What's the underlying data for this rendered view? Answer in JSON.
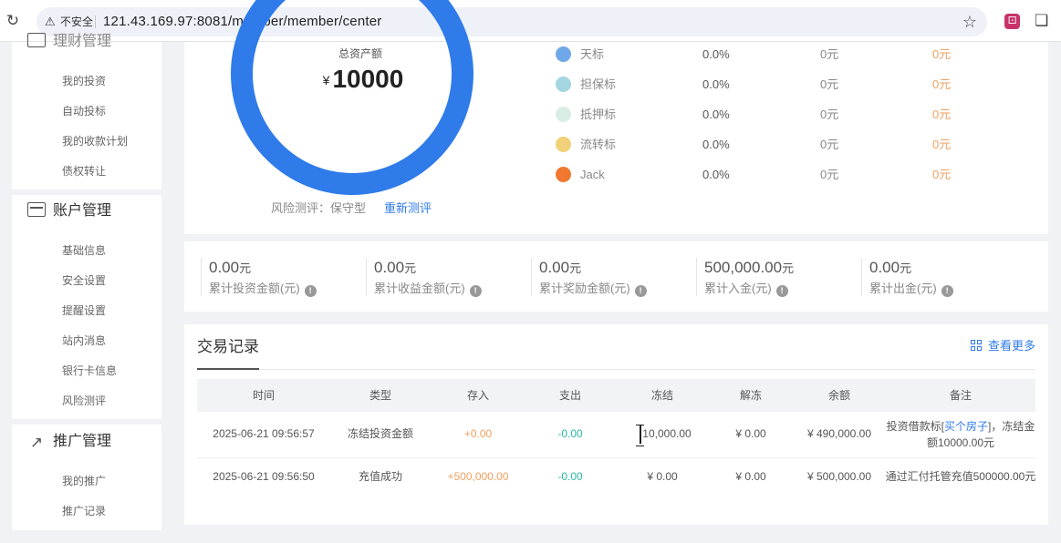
{
  "browser": {
    "insecure_label": "不安全",
    "url": "121.43.169.97:8081/member/member/center"
  },
  "sidebar": {
    "partial_header": "理财管理",
    "invest_items": [
      "我的投资",
      "自动投标",
      "我的收款计划",
      "债权转让"
    ],
    "account_header": "账户管理",
    "account_items": [
      "基础信息",
      "安全设置",
      "提醒设置",
      "站内消息",
      "银行卡信息",
      "风险测评"
    ],
    "promo_header": "推广管理",
    "promo_items": [
      "我的推广",
      "推广记录"
    ]
  },
  "assets": {
    "label": "总资产额",
    "currency": "¥",
    "total": "10000",
    "risk_text": "风险测评：保守型",
    "risk_link": "重新测评"
  },
  "products": [
    {
      "name": "天标",
      "rate": "0.0%",
      "amount": "0元",
      "earn": "0元",
      "color": "#6fa8e8"
    },
    {
      "name": "担保标",
      "rate": "0.0%",
      "amount": "0元",
      "earn": "0元",
      "color": "#a3d6e0"
    },
    {
      "name": "抵押标",
      "rate": "0.0%",
      "amount": "0元",
      "earn": "0元",
      "color": "#d9ede4"
    },
    {
      "name": "流转标",
      "rate": "0.0%",
      "amount": "0元",
      "earn": "0元",
      "color": "#f0d078"
    },
    {
      "name": "Jack",
      "rate": "0.0%",
      "amount": "0元",
      "earn": "0元",
      "color": "#f07830"
    }
  ],
  "stats": [
    {
      "value": "0.00",
      "unit": "元",
      "label": "累计投资金额(元)"
    },
    {
      "value": "0.00",
      "unit": "元",
      "label": "累计收益金额(元)"
    },
    {
      "value": "0.00",
      "unit": "元",
      "label": "累计奖励金额(元)"
    },
    {
      "value": "500,000.00",
      "unit": "元",
      "label": "累计入金(元)"
    },
    {
      "value": "0.00",
      "unit": "元",
      "label": "累计出金(元)"
    }
  ],
  "trades": {
    "title": "交易记录",
    "more": "查看更多",
    "columns": [
      "时间",
      "类型",
      "存入",
      "支出",
      "冻结",
      "解冻",
      "余额",
      "备注"
    ],
    "rows": [
      {
        "time": "2025-06-21 09:56:57",
        "type": "冻结投资金额",
        "deposit": "+0.00",
        "expense": "-0.00",
        "frozen": "10,000.00",
        "unfrozen": "¥ 0.00",
        "balance": "¥ 490,000.00",
        "note_pre": "投资借款标[",
        "note_link": "买个房子",
        "note_post": "]，冻结金额10000.00元"
      },
      {
        "time": "2025-06-21 09:56:50",
        "type": "充值成功",
        "deposit": "+500,000.00",
        "expense": "-0.00",
        "frozen": "¥ 0.00",
        "unfrozen": "¥ 0.00",
        "balance": "¥ 500,000.00",
        "note": "通过汇付托管充值500000.00元"
      }
    ]
  }
}
